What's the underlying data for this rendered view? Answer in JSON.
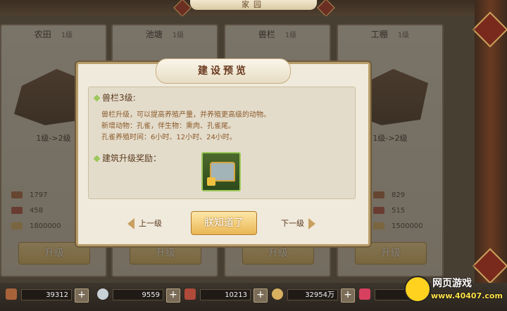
{
  "top_title": "家园",
  "cards": [
    {
      "name": "农田",
      "level": "1级",
      "upgrade": "1级->2级",
      "res": [
        "1797",
        "458",
        "1800000"
      ],
      "button": "升级"
    },
    {
      "name": "池塘",
      "level": "1级",
      "upgrade": "",
      "res": [
        "",
        "",
        ""
      ],
      "button": "升级"
    },
    {
      "name": "兽栏",
      "level": "1级",
      "upgrade": "",
      "res": [
        "",
        "",
        ""
      ],
      "button": "升级"
    },
    {
      "name": "工棚",
      "level": "1级",
      "upgrade": "1级->2级",
      "res": [
        "829",
        "515",
        "1500000"
      ],
      "button": "升级"
    }
  ],
  "dialog": {
    "title": "建设预览",
    "heading": "兽栏3级:",
    "lines": [
      "兽栏升级，可以提高养殖产量，并养殖更高级的动物。",
      "新增动物：孔雀，伴生物：熏肉、孔雀尾。",
      "孔雀养殖时间：6小时、12小时、24小时。"
    ],
    "reward_label": "建筑升级奖励：",
    "prev": "上一级",
    "next": "下一级",
    "confirm": "朕知道了"
  },
  "bottom_resources": [
    {
      "value": "39312",
      "color": "#a8623a",
      "icon": "wood-icon"
    },
    {
      "value": "9559",
      "color": "#c8d0d8",
      "icon": "stone-icon"
    },
    {
      "value": "10213",
      "color": "#b04a3a",
      "icon": "meat-icon"
    },
    {
      "value": "32954万",
      "color": "#d8b060",
      "icon": "coin-icon"
    },
    {
      "value": "0",
      "color": "#d84060",
      "icon": "ribbon-icon"
    }
  ],
  "logo": {
    "text": "网页游戏",
    "url": "www.40407.com"
  }
}
